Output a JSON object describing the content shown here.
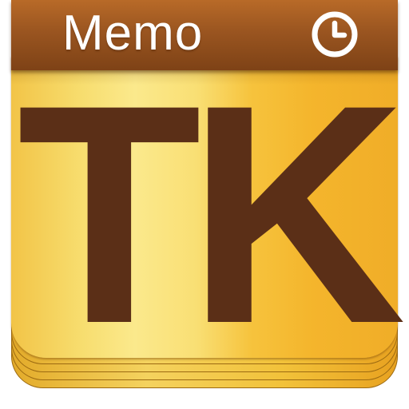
{
  "app_icon": {
    "header": {
      "title": "Memo",
      "icon": "clock-icon"
    },
    "monogram": "TK",
    "colors": {
      "header_brown": "#9a5520",
      "monogram_brown": "#5b2f17",
      "page_gold": "#f6c33d",
      "page_highlight": "#fbe98c",
      "header_text": "#ffffff"
    }
  }
}
